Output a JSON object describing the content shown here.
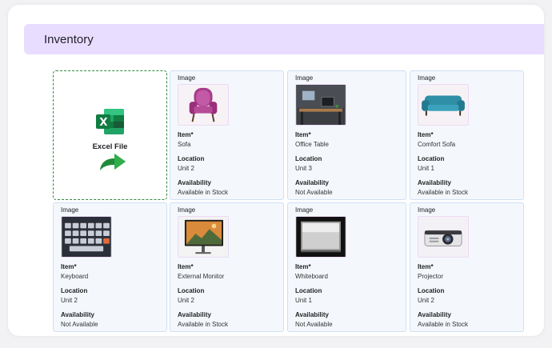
{
  "header": {
    "title": "Inventory"
  },
  "upload": {
    "label": "Excel File",
    "icon": "excel-icon",
    "arrow_icon": "share-arrow-icon",
    "accent": "#2e8b3c"
  },
  "labels": {
    "image": "Image",
    "item": "Item*",
    "location": "Location",
    "availability": "Availability"
  },
  "items": [
    {
      "item": "Sofa",
      "location": "Unit 2",
      "availability": "Available in Stock",
      "thumbnail": "armchair"
    },
    {
      "item": "Office Table",
      "location": "Unit 3",
      "availability": "Not Available",
      "thumbnail": "desk"
    },
    {
      "item": "Comfort Sofa",
      "location": "Unit 1",
      "availability": "Available in Stock",
      "thumbnail": "sofa"
    },
    {
      "item": "Keyboard",
      "location": "Unit 2",
      "availability": "Not Available",
      "thumbnail": "keyboard"
    },
    {
      "item": "External Monitor",
      "location": "Unit 2",
      "availability": "Available in Stock",
      "thumbnail": "monitor"
    },
    {
      "item": "Whiteboard",
      "location": "Unit 1",
      "availability": "Not Available",
      "thumbnail": "whiteboard"
    },
    {
      "item": "Projector",
      "location": "Unit 2",
      "availability": "Available in Stock",
      "thumbnail": "projector"
    }
  ],
  "colors": {
    "header_bg": "#e9ddff",
    "tile_bg": "#f4f8fd",
    "tile_border": "#cfe0f3"
  }
}
